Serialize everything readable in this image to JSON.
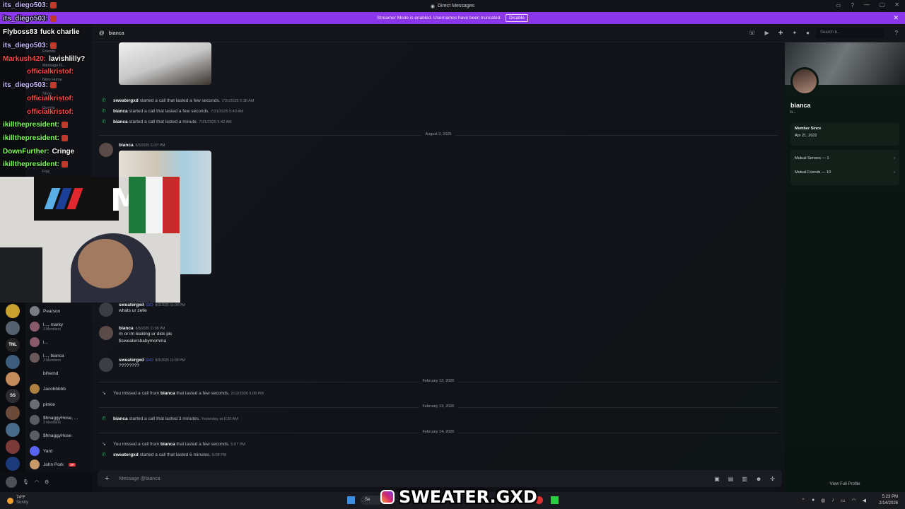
{
  "titlebar": {
    "title": "Direct Messages"
  },
  "streamer_banner": {
    "text": "Streamer Mode is enabled. Usernames have been truncated.",
    "disable_label": "Disable"
  },
  "header": {
    "channel_name": "bianca",
    "search_placeholder": "Search b..."
  },
  "dm_list": [
    {
      "name": "Pearson",
      "sub": ""
    },
    {
      "name": "l..., marky",
      "sub": "3 Members"
    },
    {
      "name": "l...",
      "sub": ""
    },
    {
      "name": "l..., bianca",
      "sub": "3 Members"
    },
    {
      "name": "bihemd",
      "sub": ""
    },
    {
      "name": "Jacobbbbb",
      "sub": ""
    },
    {
      "name": "pinkie",
      "sub": ""
    },
    {
      "name": "$hnaggyHose, ...",
      "sub": "3 Members"
    },
    {
      "name": "$hnaggyHose",
      "sub": ""
    },
    {
      "name": "Yard",
      "sub": ""
    },
    {
      "name": "John Pork",
      "sub": ""
    }
  ],
  "dm_top_items": [
    "Friends",
    "Message R...",
    "Nitro Home",
    "Shop",
    "Quests",
    "Flax"
  ],
  "rail_badge": "TNL",
  "rail_badge_2": "SS",
  "chat": {
    "calls_1": [
      {
        "who": "sweatergxd",
        "text": "started a call that lasted a few seconds.",
        "ts": "7/31/2025 5:38 AM"
      },
      {
        "who": "bianca",
        "text": "started a call that lasted a few seconds.",
        "ts": "7/31/2025 5:40 AM"
      },
      {
        "who": "bianca",
        "text": "started a call that lasted a minute.",
        "ts": "7/31/2025 5:42 AM"
      }
    ],
    "divider_1": "August 3, 2025",
    "msg_bianca_1": {
      "author": "bianca",
      "ts": "8/3/2025 11:07 PM"
    },
    "msg_sweater_1": {
      "author": "sweatergxd",
      "badge": "GXD",
      "ts": "8/3/2025 11:09 PM",
      "text": "whats ur zelle"
    },
    "msg_bianca_2": {
      "author": "bianca",
      "ts": "8/3/2025 11:09 PM",
      "line1": "rn or im leaking ur dick pic",
      "line2": "$sweatersbabymomma"
    },
    "msg_sweater_2": {
      "author": "sweatergxd",
      "badge": "GXD",
      "ts": "8/3/2025 11:09 PM",
      "text": "????????"
    },
    "divider_2": "February 12, 2026",
    "missed_1": {
      "pre": "You missed a call from",
      "who": "bianca",
      "post": "that lasted a few seconds.",
      "ts": "2/12/2026 5:08 PM"
    },
    "divider_3": "February 13, 2026",
    "call_2": {
      "who": "bianca",
      "text": "started a call that lasted 3 minutes.",
      "ts": "Yesterday at 6:30 AM"
    },
    "divider_4": "February 14, 2026",
    "missed_2": {
      "pre": "You missed a call from",
      "who": "bianca",
      "post": "that lasted a few seconds.",
      "ts": "5:07 PM"
    },
    "call_3": {
      "who": "sweatergxd",
      "text": "started a call that lasted 6 minutes.",
      "ts": "5:08 PM"
    }
  },
  "composer": {
    "placeholder": "Message @bianca"
  },
  "profile": {
    "name": "bianca",
    "sub": "b...",
    "member_since_label": "Member Since",
    "member_since": "Apr 21, 2022",
    "mutual_servers": "Mutual Servers — 1",
    "mutual_friends": "Mutual Friends — 10",
    "view_full": "View Full Profile"
  },
  "stream_chat": [
    {
      "user": "its_diego503:",
      "color": "#c9b8ff",
      "msg": ""
    },
    {
      "user": "its_diego503:",
      "color": "#c9b8ff",
      "msg": ""
    },
    {
      "user": "Flyboss83",
      "color": "#ffffff",
      "msg": "fuck charlie"
    },
    {
      "user": "its_diego503:",
      "color": "#c9b8ff",
      "msg": ""
    },
    {
      "user": "Markush420:",
      "color": "#ff4b4b",
      "msg": "lavishlilly?"
    },
    {
      "user": "officialkristof:",
      "color": "#ff4b4b",
      "msg": ""
    },
    {
      "user": "its_diego503:",
      "color": "#c9b8ff",
      "msg": ""
    },
    {
      "user": "officialkristof:",
      "color": "#ff4b4b",
      "msg": ""
    },
    {
      "user": "officialkristof:",
      "color": "#ff4b4b",
      "msg": ""
    },
    {
      "user": "ikillthepresident:",
      "color": "#7dff5a",
      "msg": ""
    },
    {
      "user": "ikillthepresident:",
      "color": "#7dff5a",
      "msg": ""
    },
    {
      "user": "DownFurther:",
      "color": "#7dff5a",
      "msg": "Cringe"
    },
    {
      "user": "ikillthepresident:",
      "color": "#7dff5a",
      "msg": ""
    }
  ],
  "taskbar": {
    "temp": "74°F",
    "weather": "Sunny",
    "search": "Se",
    "time": "5:23 PM",
    "date": "2/14/2026"
  },
  "watermark": {
    "text": "SWEATER.GXD"
  },
  "colors": {
    "banner": "#8b36e8",
    "green": "#23a55a",
    "accent": "#5865f2"
  }
}
